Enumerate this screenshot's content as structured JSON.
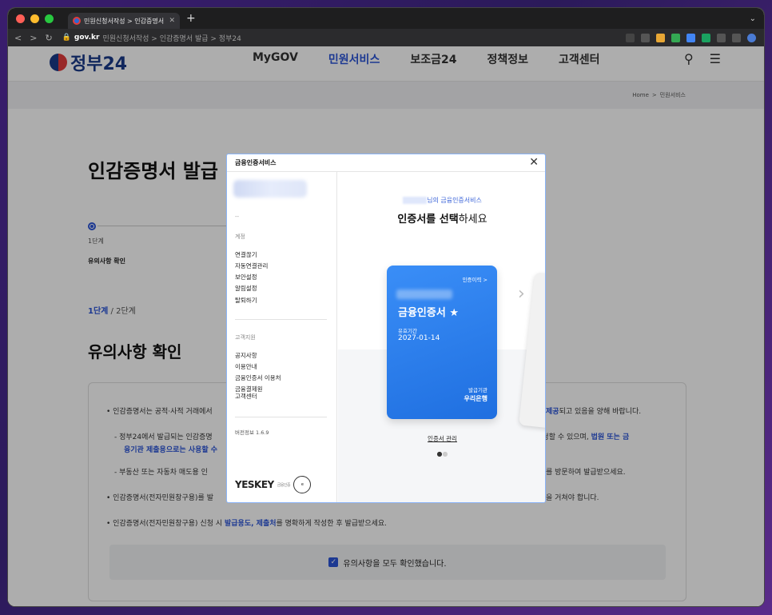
{
  "browser": {
    "tab_title": "민원신청서작성 > 인감증명서 발급",
    "new_tab": "+",
    "nav_back": "<",
    "nav_forward": ">",
    "reload": "C",
    "url_host": "gov.kr",
    "url_path": "민원신청서작성 > 인감증명서 발급 > 정부24"
  },
  "site": {
    "logo_text": "정부24",
    "nav": [
      "MyGOV",
      "민원서비스",
      "보조금24",
      "정책정보",
      "고객센터"
    ],
    "active_nav": 1,
    "breadcrumb_home": "Home",
    "breadcrumb_sep": ">",
    "breadcrumb_current": "민원서비스"
  },
  "page": {
    "title": "인감증명서 발급",
    "step_label": "1단계",
    "step_name": "유의사항 확인",
    "step_current": "1단계",
    "step_total": " / 2단계",
    "section_title": "유의사항 확인",
    "notice": {
      "line1a": "• 인감증명서는 공적·사적 거래에서",
      "line1b": "제공",
      "line1c": "되고 있음을 양해 바랍니다.",
      "line2a": "- 정부24에서 발급되는 인감증명",
      "line2b": "만 신청할 수 있으며,",
      "line2c": "법원 또는 금",
      "line3a": "융기관 제출용으로는 사용할 수",
      "line4a": "- 부동산 또는 자동차 매도용 인",
      "line4b": "를 방문하여 발급받으세요.",
      "line5a": "• 인감증명서(전자민원창구용)를 발",
      "line5b": "을 거쳐야 합니다.",
      "line6a": "• 인감증명서(전자민원창구용) 신청 시",
      "line6b": "발급용도, 제출처",
      "line6c": "를 명확하게 작성한 후 발급받으세요."
    },
    "confirm_label": "유의사항을 모두 확인했습니다."
  },
  "modal": {
    "title": "금융인증서비스",
    "close": "✕",
    "dash": "--",
    "group1": "계정",
    "menu1": [
      "연결끊기",
      "자동연결관리",
      "보안설정",
      "알림설정",
      "탈퇴하기"
    ],
    "group2": "고객지원",
    "menu2": [
      "공지사항",
      "이용안내",
      "금융인증서 이용처",
      "금융결제원\n고객센터"
    ],
    "version": "버전정보 1.6.9",
    "brand": "YESKEY",
    "brand_sub": "금융인증",
    "seal_text": "TRUST eSign",
    "greeting_suffix": "님의 금융인증서비스",
    "select_bold": "인증서를 선택",
    "select_rest": "하세요",
    "card": {
      "history": "인증이력 >",
      "name": "금융인증서 ★",
      "valid_label": "유효기간",
      "valid_date": "2027-01-14",
      "issuer_label": "발급기관",
      "issuer": "우리은행"
    },
    "manage": "인증서 관리"
  }
}
